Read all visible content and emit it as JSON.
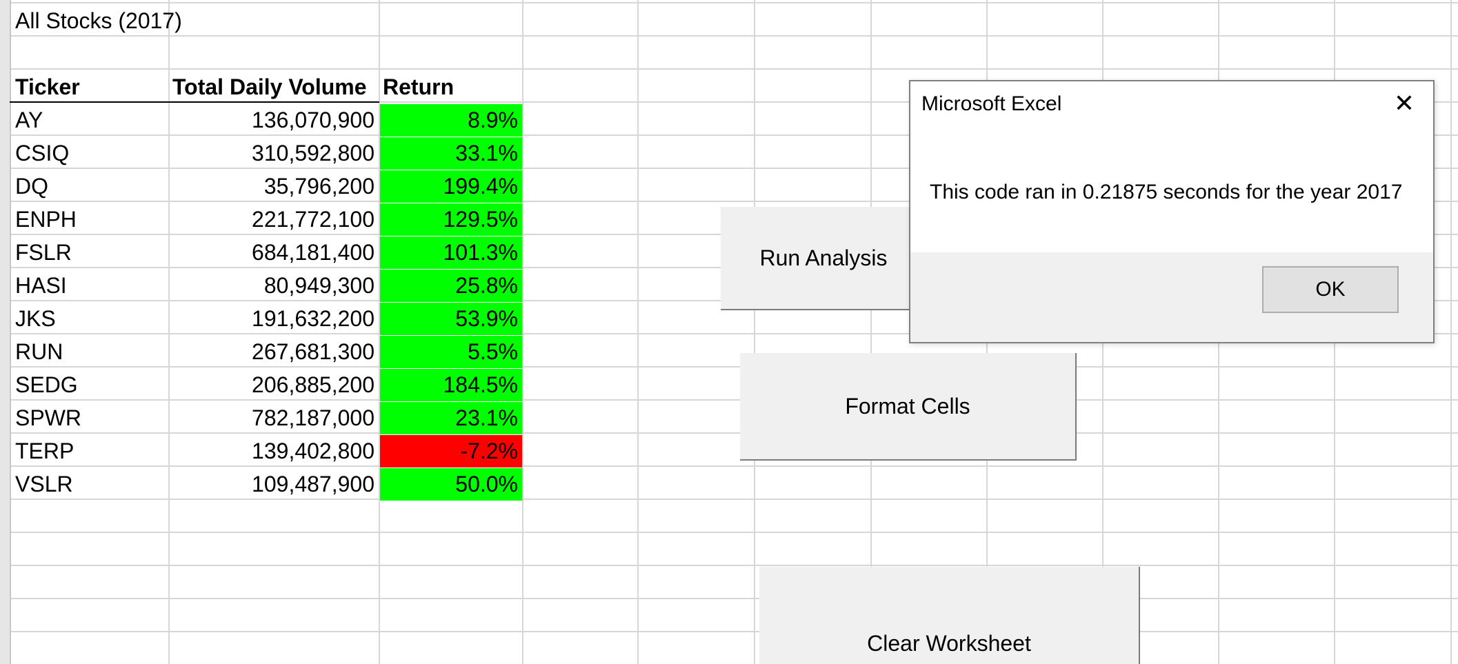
{
  "sheet": {
    "title": "All Stocks (2017)",
    "headers": {
      "ticker": "Ticker",
      "volume": "Total Daily Volume",
      "return": "Return"
    },
    "rows": [
      {
        "ticker": "AY",
        "volume": "136,070,900",
        "return": "8.9%",
        "status": "positive"
      },
      {
        "ticker": "CSIQ",
        "volume": "310,592,800",
        "return": "33.1%",
        "status": "positive"
      },
      {
        "ticker": "DQ",
        "volume": "35,796,200",
        "return": "199.4%",
        "status": "positive"
      },
      {
        "ticker": "ENPH",
        "volume": "221,772,100",
        "return": "129.5%",
        "status": "positive"
      },
      {
        "ticker": "FSLR",
        "volume": "684,181,400",
        "return": "101.3%",
        "status": "positive"
      },
      {
        "ticker": "HASI",
        "volume": "80,949,300",
        "return": "25.8%",
        "status": "positive"
      },
      {
        "ticker": "JKS",
        "volume": "191,632,200",
        "return": "53.9%",
        "status": "positive"
      },
      {
        "ticker": "RUN",
        "volume": "267,681,300",
        "return": "5.5%",
        "status": "positive"
      },
      {
        "ticker": "SEDG",
        "volume": "206,885,200",
        "return": "184.5%",
        "status": "positive"
      },
      {
        "ticker": "SPWR",
        "volume": "782,187,000",
        "return": "23.1%",
        "status": "positive"
      },
      {
        "ticker": "TERP",
        "volume": "139,402,800",
        "return": "-7.2%",
        "status": "negative"
      },
      {
        "ticker": "VSLR",
        "volume": "109,487,900",
        "return": "50.0%",
        "status": "positive"
      }
    ],
    "colors": {
      "positive": "#00ff00",
      "negative": "#ff0000"
    }
  },
  "buttons": {
    "run_analysis": "Run Analysis",
    "format_cells": "Format Cells",
    "clear_worksheet": "Clear Worksheet"
  },
  "dialog": {
    "title": "Microsoft Excel",
    "close_icon": "close-icon",
    "message": "This code ran in 0.21875 seconds for the year 2017",
    "ok_label": "OK"
  }
}
